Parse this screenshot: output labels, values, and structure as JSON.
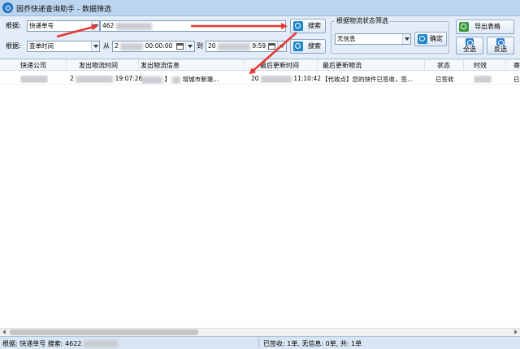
{
  "window": {
    "title": "固乔快递查询助手 - 数据筛选"
  },
  "filter1": {
    "label": "根据:",
    "field": "快递单号",
    "value_prefix": "462",
    "search_label": "搜索"
  },
  "filter2": {
    "label": "根据:",
    "field": "查单时间",
    "from_label": "从",
    "from_prefix": "2",
    "from_time": "00:00:00",
    "to_label": "到",
    "to_prefix": "20",
    "to_time": "9:59",
    "search_label": "搜索"
  },
  "status_filter": {
    "title": "根据物流状态筛选",
    "selected": "无信息",
    "confirm_label": "确定"
  },
  "buttons": {
    "export": "导出表格",
    "select_all": "全选",
    "invert": "反选"
  },
  "table": {
    "columns": [
      "快递公司",
      "发出物流时间",
      "发出物流信息",
      "最后更新时间",
      "最后更新物流",
      "状态",
      "时效",
      "寄"
    ],
    "rows": [
      {
        "company": "",
        "sent_prefix": "2",
        "sent_time": "19:07:26",
        "sent_info_bracket": "】",
        "sent_info": "增城市新塘...",
        "updated_prefix": "20",
        "updated_time": "11:10:42",
        "latest": "【代收点】您的快件已签收，签...",
        "status": "已签收",
        "duration": "",
        "extra": "已"
      }
    ]
  },
  "status_bar": {
    "left_prefix": "根据: 快递单号 搜索: 4622",
    "right": "已签收: 1单, 无信息: 0单, 共: 1单"
  },
  "colors": {
    "accent": "#1e88c9",
    "arrow": "#e53935",
    "panel_bg": "#e3ecf7"
  }
}
